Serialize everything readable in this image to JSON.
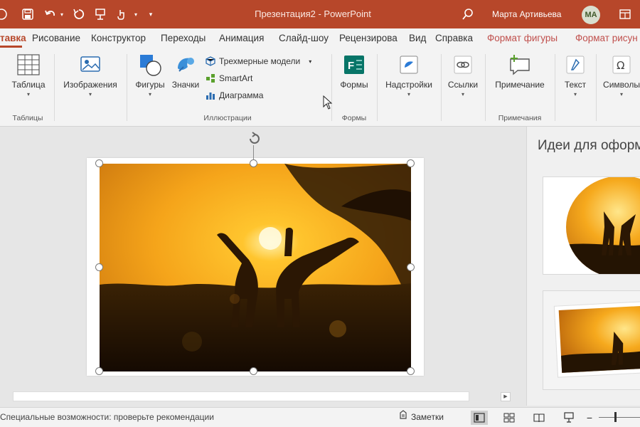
{
  "window": {
    "title": "Презентация2  -  PowerPoint",
    "user_name": "Марта Артивьева",
    "user_initials": "MA"
  },
  "tabs": [
    {
      "label": "тавка",
      "active": true
    },
    {
      "label": "Рисование"
    },
    {
      "label": "Конструктор"
    },
    {
      "label": "Переходы"
    },
    {
      "label": "Анимация"
    },
    {
      "label": "Слайд-шоу"
    },
    {
      "label": "Рецензирова"
    },
    {
      "label": "Вид"
    },
    {
      "label": "Справка"
    },
    {
      "label": "Формат фигуры",
      "contextual": true
    },
    {
      "label": "Формат рисун",
      "contextual": true
    }
  ],
  "ribbon": {
    "table_label": "Таблица",
    "images_label": "Изображения",
    "shapes_label": "Фигуры",
    "icons_label": "Значки",
    "models3d_label": "Трехмерные модели",
    "smartart_label": "SmartArt",
    "chart_label": "Диаграмма",
    "forms_label": "Формы",
    "addins_label": "Надстройки",
    "links_label": "Ссылки",
    "comment_label": "Примечание",
    "text_label": "Текст",
    "symbols_label": "Символы",
    "groups": {
      "tables": "Таблицы",
      "illustrations": "Иллюстрации",
      "forms": "Формы",
      "comments": "Примечания"
    }
  },
  "designer": {
    "title": "Идеи для оформ"
  },
  "statusbar": {
    "accessibility": "Специальные возможности: проверьте рекомендации",
    "notes": "Заметки"
  },
  "colors": {
    "accent": "#b7472a",
    "contextual_tab": "#c0504d"
  }
}
